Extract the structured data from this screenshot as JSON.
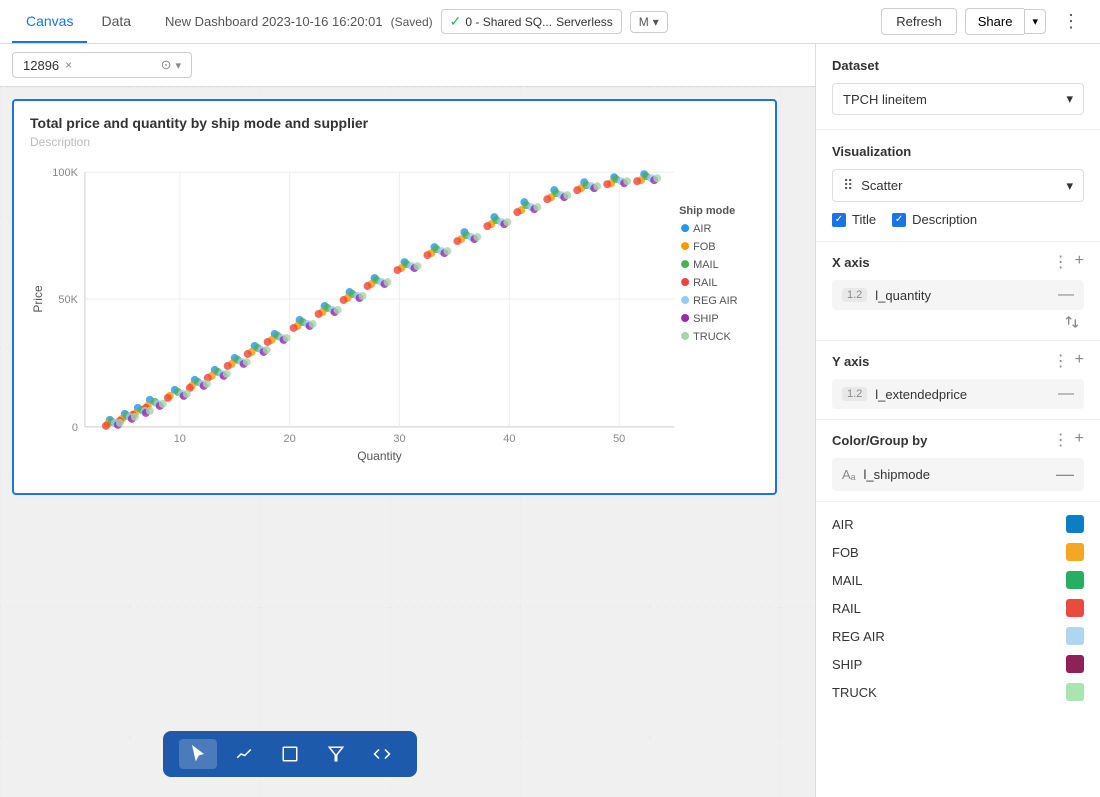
{
  "topbar": {
    "tabs": [
      {
        "id": "canvas",
        "label": "Canvas",
        "active": true
      },
      {
        "id": "data",
        "label": "Data",
        "active": false
      }
    ],
    "dashboard_title": "New Dashboard 2023-10-16 16:20:01",
    "saved_text": "(Saved)",
    "status_label": "0 - Shared SQ...",
    "serverless_label": "Serverless",
    "mode_label": "M",
    "refresh_label": "Refresh",
    "share_label": "Share"
  },
  "filter": {
    "value": "12896",
    "clear_icon": "×"
  },
  "chart": {
    "title": "Total price and quantity by ship mode and supplier",
    "description": "Description",
    "legend_title": "Ship mode",
    "legend_items": [
      {
        "label": "AIR",
        "color": "#2196F3"
      },
      {
        "label": "FOB",
        "color": "#FF9800"
      },
      {
        "label": "MAIL",
        "color": "#4CAF50"
      },
      {
        "label": "RAIL",
        "color": "#F44336"
      },
      {
        "label": "REG AIR",
        "color": "#90CAF9"
      },
      {
        "label": "SHIP",
        "color": "#9C27B0"
      },
      {
        "label": "TRUCK",
        "color": "#A5D6A7"
      }
    ],
    "x_axis_label": "Quantity",
    "y_axis_label": "Price",
    "x_ticks": [
      "10",
      "20",
      "30",
      "40",
      "50"
    ],
    "y_ticks": [
      "100K",
      "50K",
      "0"
    ]
  },
  "toolbar_buttons": [
    {
      "id": "cursor",
      "icon": "⬡",
      "active": true
    },
    {
      "id": "line",
      "icon": "⟋",
      "active": false
    },
    {
      "id": "box",
      "icon": "⬜",
      "active": false
    },
    {
      "id": "filter",
      "icon": "⬦",
      "active": false
    },
    {
      "id": "code",
      "icon": "⟨⟩",
      "active": false
    }
  ],
  "right_panel": {
    "dataset_label": "Dataset",
    "dataset_value": "TPCH lineitem",
    "visualization_label": "Visualization",
    "visualization_value": "Scatter",
    "title_label": "Title",
    "description_label": "Description",
    "x_axis_label": "X axis",
    "x_axis_field_type": "1.2",
    "x_axis_field_name": "l_quantity",
    "y_axis_label": "Y axis",
    "y_axis_field_type": "1.2",
    "y_axis_field_name": "l_extendedprice",
    "color_group_label": "Color/Group by",
    "color_field_icon": "Aₐ",
    "color_field_name": "l_shipmode",
    "shipmodes": [
      {
        "label": "AIR",
        "color": "#0D7EC4"
      },
      {
        "label": "FOB",
        "color": "#F5A623"
      },
      {
        "label": "MAIL",
        "color": "#27AE60"
      },
      {
        "label": "RAIL",
        "color": "#E74C3C"
      },
      {
        "label": "REG AIR",
        "color": "#AED6F1"
      },
      {
        "label": "SHIP",
        "color": "#8E2157"
      },
      {
        "label": "TRUCK",
        "color": "#A8E6B0"
      }
    ]
  }
}
